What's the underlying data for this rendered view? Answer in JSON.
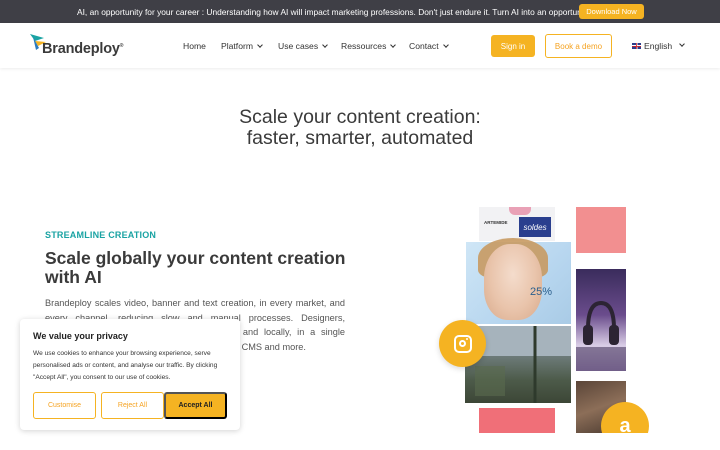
{
  "announcement": {
    "text": "AI, an opportunity for your career : Understanding how AI will impact marketing professions. Don't just endure it. Turn AI into an opportunity.",
    "button_label": "Download Now"
  },
  "nav": {
    "brand": "Brandeploy",
    "brand_mark": "®",
    "items": [
      {
        "label": "Home",
        "dropdown": false
      },
      {
        "label": "Platform",
        "dropdown": true
      },
      {
        "label": "Use cases",
        "dropdown": true
      },
      {
        "label": "Ressources",
        "dropdown": true
      },
      {
        "label": "Contact",
        "dropdown": true
      }
    ],
    "sign_in": "Sign in",
    "book_demo": "Book a demo",
    "language": "English"
  },
  "hero": {
    "title_line1": "Scale your content creation:",
    "title_line2": "faster, smarter, automated"
  },
  "section": {
    "eyebrow": "STREAMLINE CREATION",
    "title": "Scale globally your content creation with AI",
    "body": "Brandeploy scales video, banner and text creation, in every market, and every channel, reducing slow and manual processes. Designers, marketers and agencies collaborate globally and locally, in a single workspace, with seamless connections to DAM, CMS and more."
  },
  "collage": {
    "tile_brand_text": "ARTEMIDE",
    "tile_promo_text": "soldes",
    "discount_text": "25%",
    "amazon_glyph": "a",
    "icons": [
      "instagram-icon",
      "amazon-icon"
    ]
  },
  "cookie": {
    "title": "We value your privacy",
    "body": "We use cookies to enhance your browsing experience, serve personalised ads or content, and analyse our traffic. By clicking \"Accept All\", you consent to our use of cookies.",
    "customise": "Customise",
    "reject": "Reject All",
    "accept": "Accept All"
  },
  "colors": {
    "accent": "#f5b322",
    "teal": "#1aa3a3",
    "topbar": "#3f3f46"
  }
}
